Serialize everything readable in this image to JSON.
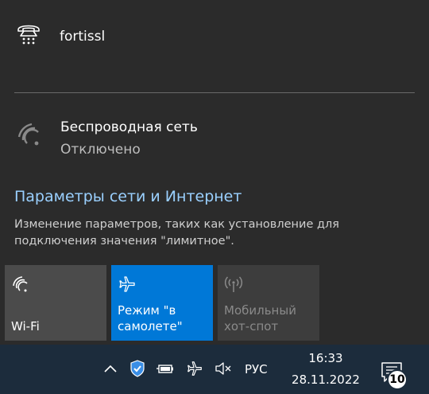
{
  "vpn": {
    "name": "fortissl",
    "icon": "dialup-connection-icon"
  },
  "wireless": {
    "title": "Беспроводная сеть",
    "status": "Отключено",
    "icon": "wifi-off-icon"
  },
  "settings": {
    "link": "Параметры сети и Интернет",
    "description": "Изменение параметров, таких как установление для подключения значения \"лимитное\"."
  },
  "tiles": [
    {
      "label": "Wi-Fi",
      "icon": "wifi-icon",
      "state": "off"
    },
    {
      "label": "Режим \"в самолете\"",
      "icon": "airplane-icon",
      "state": "on"
    },
    {
      "label": "Мобильный хот-спот",
      "icon": "hotspot-icon",
      "state": "disabled"
    }
  ],
  "taskbar": {
    "language": "РУС",
    "time": "16:33",
    "date": "28.11.2022",
    "notification_count": "10"
  },
  "colors": {
    "flyout_bg": "#2b2b2b",
    "accent": "#0078d7",
    "link": "#9ad0ff",
    "taskbar_bg": "#1c2c3c"
  }
}
